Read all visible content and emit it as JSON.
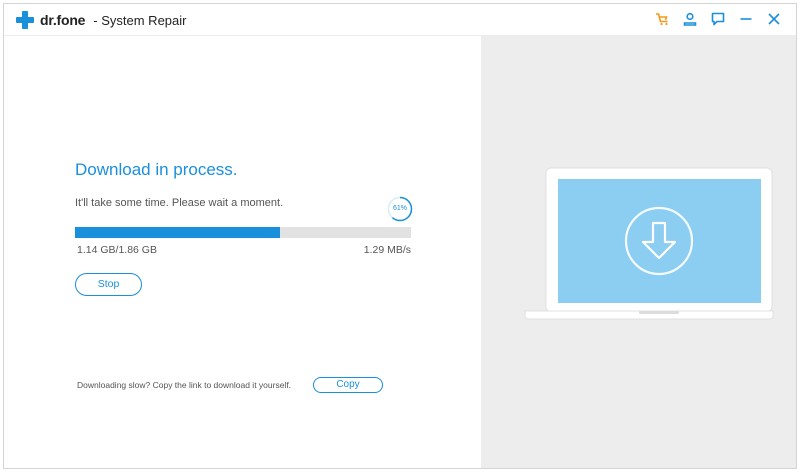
{
  "app": {
    "brand": "dr.fone",
    "title": "- System Repair"
  },
  "window_controls": [
    {
      "icon": "cart-icon",
      "color": "#f39a18"
    },
    {
      "icon": "user-icon",
      "color": "#1a8fdc"
    },
    {
      "icon": "feedback-icon",
      "color": "#1a8fdc"
    },
    {
      "icon": "minimize-icon",
      "color": "#1a8fdc"
    },
    {
      "icon": "close-icon",
      "color": "#1a8fdc"
    }
  ],
  "download": {
    "heading": "Download in process.",
    "message": "It'll take some time. Please wait a moment.",
    "percent_label": "61%",
    "progress": 0.61,
    "size": "1.14 GB/1.86 GB",
    "speed": "1.29 MB/s",
    "stop_label": "Stop",
    "slow_text": "Downloading slow? Copy the link to download it yourself.",
    "copy_label": "Copy"
  },
  "illustration": {
    "icon": "download-arrow-icon",
    "screen_color": "#8ccdf2"
  },
  "colors": {
    "accent": "#1a8fdc",
    "cart": "#f39a18",
    "track": "#e2e2e2",
    "right_pane": "#ededed"
  }
}
